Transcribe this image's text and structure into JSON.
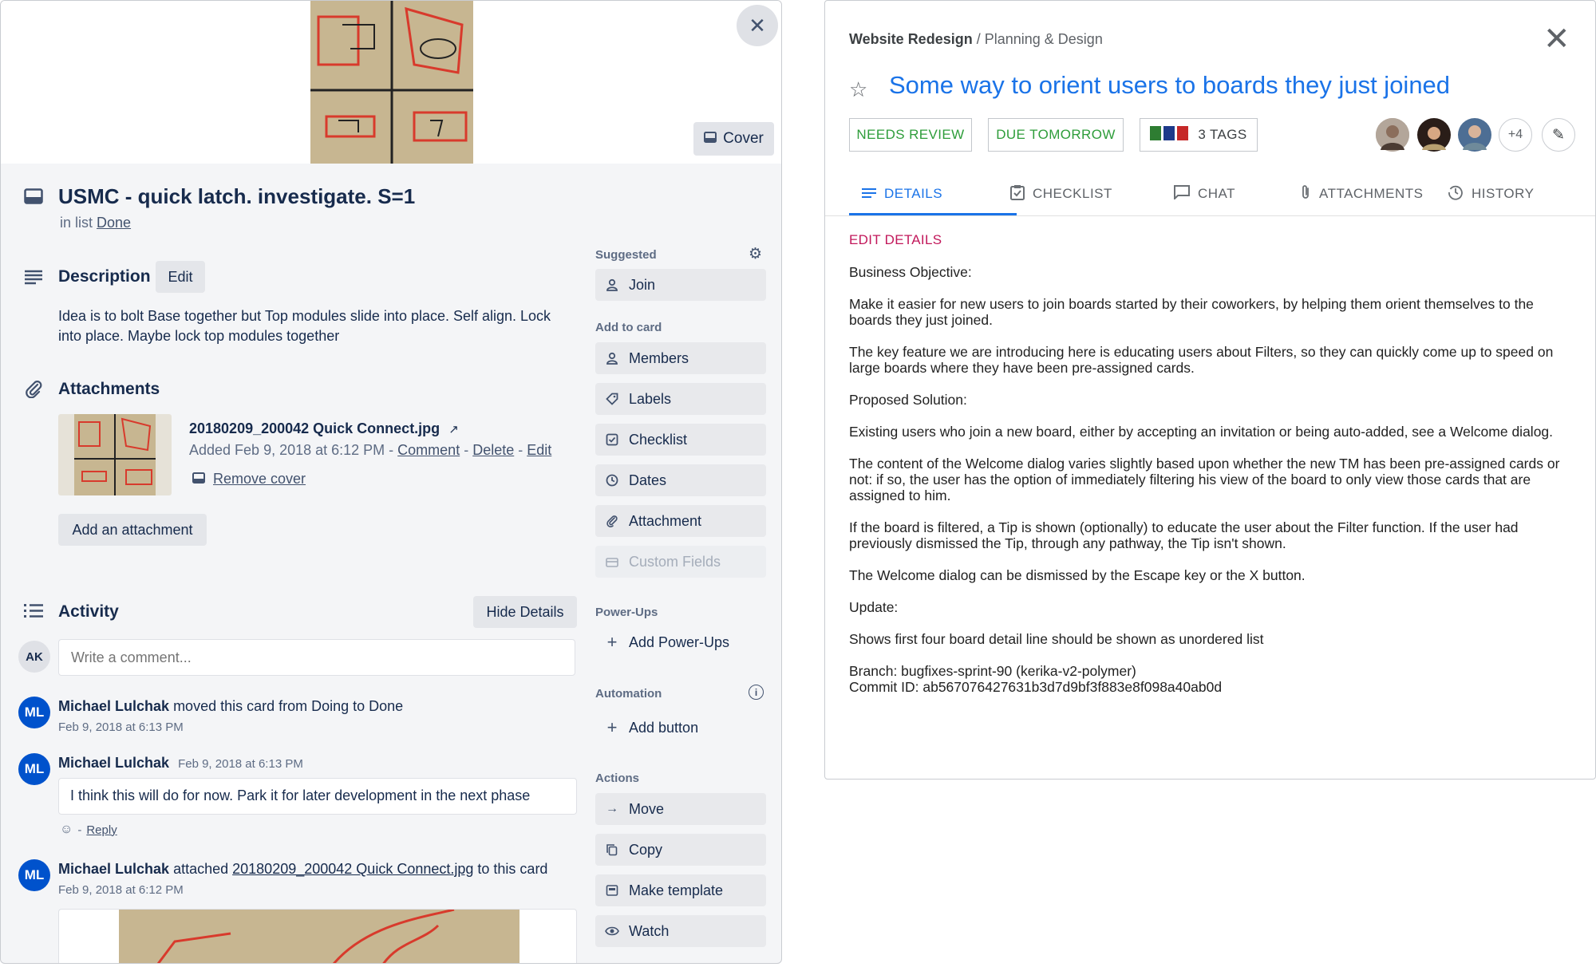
{
  "trello": {
    "cover_label": "Cover",
    "card_title": "USMC - quick latch. investigate. S=1",
    "list_prefix": "in list",
    "list_name": "Done",
    "description": {
      "heading": "Description",
      "edit_label": "Edit",
      "text": "Idea is to bolt Base together but Top modules slide into place. Self align. Lock into place. Maybe lock top modules together"
    },
    "attachments": {
      "heading": "Attachments",
      "file_name": "20180209_200042 Quick Connect.jpg",
      "added_text": "Added Feb 9, 2018 at 6:12 PM - ",
      "comment_link": "Comment",
      "delete_link": "Delete",
      "edit_link": "Edit",
      "remove_cover": "Remove cover",
      "add_label": "Add an attachment"
    },
    "activity": {
      "heading": "Activity",
      "hide_details": "Hide Details",
      "user_initials": "AK",
      "comment_placeholder": "Write a comment...",
      "entries": [
        {
          "initials": "ML",
          "name": "Michael Lulchak",
          "action": "moved this card from Doing to Done",
          "time": "Feb 9, 2018 at 6:13 PM"
        },
        {
          "initials": "ML",
          "name": "Michael Lulchak",
          "time": "Feb 9, 2018 at 6:13 PM",
          "comment": "I think this will do for now. Park it for later development in the next phase",
          "reply": "Reply"
        },
        {
          "initials": "ML",
          "name": "Michael Lulchak",
          "action_pre": "attached",
          "file": "20180209_200042 Quick Connect.jpg",
          "action_post": "to this card",
          "time": "Feb 9, 2018 at 6:12 PM"
        }
      ]
    },
    "sidebar": {
      "suggested": "Suggested",
      "join": "Join",
      "add_to_card": "Add to card",
      "members": "Members",
      "labels": "Labels",
      "checklist": "Checklist",
      "dates": "Dates",
      "attachment": "Attachment",
      "custom_fields": "Custom Fields",
      "power_ups": "Power-Ups",
      "add_power_ups": "Add Power-Ups",
      "automation": "Automation",
      "add_button": "Add button",
      "actions": "Actions",
      "move": "Move",
      "copy": "Copy",
      "make_template": "Make template",
      "watch": "Watch"
    }
  },
  "kerika": {
    "board": "Website Redesign",
    "separator": " / ",
    "column": "Planning & Design",
    "title": "Some way to orient users to boards they just joined",
    "tags": {
      "needs_review": "NEEDS REVIEW",
      "due_tomorrow": "DUE TOMORROW",
      "tags_count": "3 TAGS"
    },
    "more_members": "+4",
    "tabs": {
      "details": "DETAILS",
      "checklist": "CHECKLIST",
      "chat": "CHAT",
      "attachments": "ATTACHMENTS",
      "history": "HISTORY"
    },
    "edit_details": "EDIT DETAILS",
    "paragraphs": [
      "Business Objective:",
      "Make it easier for new users to join boards started by their coworkers, by helping them orient themselves to the boards they just joined.",
      "The key feature we are introducing here is educating users about Filters, so they can quickly come up to speed on large boards where they have been pre-assigned cards.",
      "Proposed Solution:",
      "Existing users who join a new board, either by accepting an invitation or being auto-added, see a Welcome dialog.",
      "The content of the Welcome dialog varies slightly based upon whether the new TM has been pre-assigned cards or not: if so, the user has the option of immediately filtering his view of the board to only view those cards that are assigned to him.",
      "If the board is filtered, a Tip is shown (optionally) to educate the user about the Filter function. If the user had previously dismissed the Tip, through any pathway, the Tip isn't shown.",
      "The Welcome dialog can be dismissed by the Escape key or the X button.",
      "Update:",
      "Shows first four board detail line should be shown as unordered list"
    ],
    "branch": "Branch: bugfixes-sprint-90 (kerika-v2-polymer)",
    "commit": "Commit ID: ab567076427631b3d7d9bf3f883e8f098a40ab0d"
  }
}
